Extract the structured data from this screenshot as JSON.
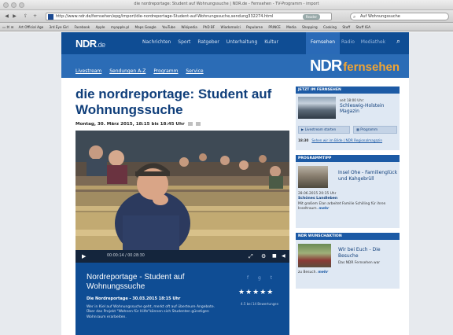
{
  "browser": {
    "window_title": "die nordreportage: Student auf Wohnungssuche | NDR.de - Fernsehen - TV-Programm - import",
    "url": "http://www.ndr.de/fernsehen/epg/import/die-nordreportage-Student-auf-Wohnungssuche,sendung332274.html",
    "reader_label": "Reader",
    "search_value": "Auf Wohnungssuche",
    "bookmarks": [
      "Art Official Age",
      "3rd Eye Girl",
      "Facebook",
      "Apple",
      "myapple.pl",
      "Maps Google",
      "YouTube",
      "Wikipedia",
      "PhD BF",
      "Wiadomości",
      "Popularne",
      "PRINCE",
      "Media",
      "Shopping",
      "Cooking",
      "Stuff",
      "Stuff IGA"
    ]
  },
  "site": {
    "logo": "NDR",
    "logo_suffix": ".de",
    "nav": [
      "Nachrichten",
      "Sport",
      "Ratgeber",
      "Unterhaltung",
      "Kultur"
    ],
    "nav_active": "Fernsehen",
    "nav_secondary": [
      "Radio",
      "Mediathek"
    ],
    "sublinks": [
      "Livestream",
      "Sendungen A-Z",
      "Programm",
      "Service"
    ],
    "brand_ndr": "NDR",
    "brand_fernsehen": "fernsehen"
  },
  "article": {
    "headline": "die nordreportage: Student auf Wohnungssuche",
    "dateline": "Montag, 30. März 2015, 18:15 bis 18:45 Uhr"
  },
  "player": {
    "time": "00:00:14 / 00:28:30"
  },
  "video_info": {
    "title": "Nordreportage - Student auf Wohnungssuche",
    "subtitle": "Die Nordreportage - 30.03.2015 18:15 Uhr",
    "description": "Wer in Kiel auf Wohnungssuche geht, merkt oft auf überteure Angebote. Über das Projekt \"Wohnen für Hilfe\"können sich Studenten günstigen Wohnraum erarbeiten.",
    "stars": "★★★★★",
    "rating_count": "4.5 bei 14 Bewertungen"
  },
  "sidebar": {
    "tv": {
      "heading": "JETZT IM FERNSEHEN",
      "time": "seit 18:00 Uhr:",
      "title": "Schleswig-Holstein Magazin",
      "livestream_btn": "Livestream starten",
      "programm_btn": "Programm",
      "next_time": "18:30",
      "next_link": "Sehen wir im Bilde | NDR Regionalmagazin"
    },
    "tipp": {
      "heading": "PROGRAMMTIPP",
      "title": "Insel Ohe - Familienglück und Kahgebrüll",
      "date": "28.06.2015 20:15 Uhr",
      "show": "Schönes Landleben",
      "desc": "Mit großem Elan arbeitet Familie Schilling für ihren Inseltraum.",
      "more": "mehr"
    },
    "wunsch": {
      "heading": "NDR WUNSCHAKTION",
      "title": "Wir bei Euch - Die Besuche",
      "desc": "Das NDR Fernsehen war",
      "desc2": "zu Besuch.",
      "more": "mehr"
    }
  },
  "colors": {
    "ndr_blue": "#0f4d94",
    "ndr_orange": "#f2a533",
    "sidebar_bg": "#dfe8f3"
  }
}
